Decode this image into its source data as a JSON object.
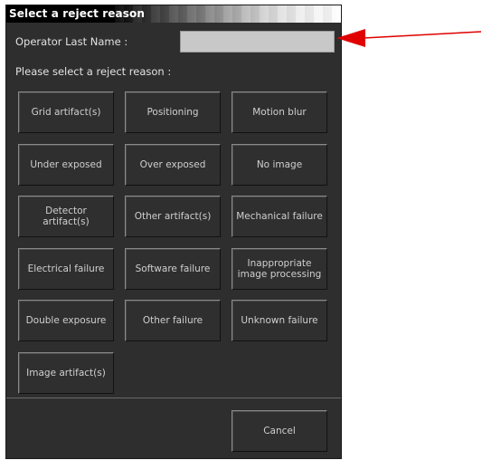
{
  "dialog": {
    "title": "Select a reject reason",
    "operator_label": "Operator Last Name :",
    "operator_value": "",
    "prompt": "Please select a reject reason :",
    "reasons": [
      "Grid artifact(s)",
      "Positioning",
      "Motion blur",
      "Under exposed",
      "Over exposed",
      "No image",
      "Detector artifact(s)",
      "Other artifact(s)",
      "Mechanical failure",
      "Electrical failure",
      "Software failure",
      "Inappropriate\nimage processing",
      "Double exposure",
      "Other failure",
      "Unknown failure",
      "Image artifact(s)"
    ],
    "cancel_label": "Cancel"
  },
  "colors": {
    "dialog_bg": "#2e2e2e",
    "button_text": "#cfcfcf",
    "input_bg": "#c8c8c8",
    "annotation_arrow": "#e00000"
  },
  "annotation": {
    "icon": "arrow-left-icon"
  }
}
